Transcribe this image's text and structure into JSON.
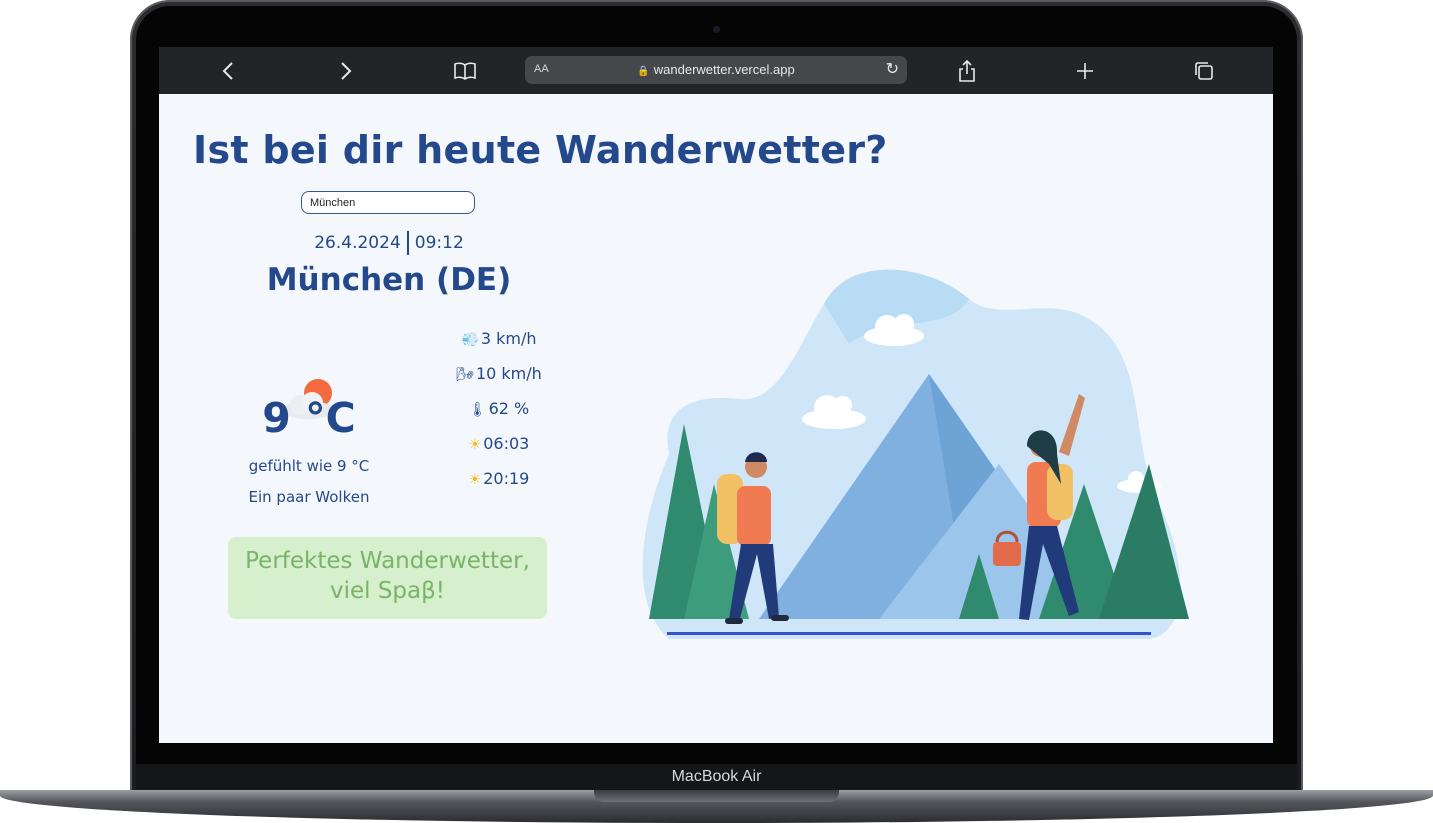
{
  "device": {
    "label": "MacBook Air"
  },
  "browser": {
    "back_icon": "‹",
    "forward_icon": "›",
    "bookmarks_icon": "book-icon",
    "text_size_label": "AA",
    "url": "wanderwetter.vercel.app",
    "reload_icon": "↻",
    "share_icon": "share-icon",
    "new_tab_icon": "+",
    "tabs_icon": "tabs-icon"
  },
  "page": {
    "title": "Ist bei dir heute Wanderwetter?",
    "search": {
      "value": "München"
    },
    "date": "26.4.2024",
    "time": "09:12",
    "city": "München (DE)",
    "weather": {
      "icon": "cloud-sun-icon",
      "temperature": "9 °C",
      "feels_like": "gefühlt wie 9 °C",
      "description": "Ein paar Wolken"
    },
    "stats": [
      {
        "icon": "wind-icon",
        "glyph": "💨",
        "value": "3 km/h"
      },
      {
        "icon": "gust-icon",
        "glyph": "🌬",
        "value": "10 km/h"
      },
      {
        "icon": "humidity-thermometer-icon",
        "glyph": "🌡",
        "value": "62 %"
      },
      {
        "icon": "sunrise-icon",
        "glyph": "☀",
        "value": "06:03"
      },
      {
        "icon": "sunset-icon",
        "glyph": "☀",
        "value": "20:19"
      }
    ],
    "verdict_line1": "Perfektes Wanderwetter,",
    "verdict_line2": "viel Spaβ!"
  },
  "colors": {
    "primary": "#24488c",
    "verdict_bg": "#d6efcc",
    "verdict_text": "#7ab36a",
    "page_bg": "#f4f8fc"
  }
}
